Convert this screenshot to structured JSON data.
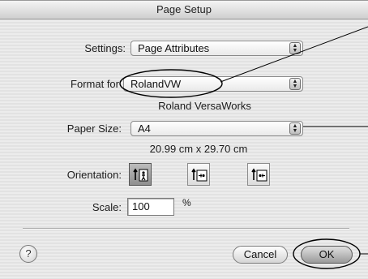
{
  "window": {
    "title": "Page Setup"
  },
  "settings": {
    "label": "Settings:",
    "value": "Page Attributes"
  },
  "format_for": {
    "label": "Format for",
    "value": "RolandVW",
    "printer_name": "Roland VersaWorks"
  },
  "paper_size": {
    "label": "Paper Size:",
    "value": "A4",
    "dimensions": "20.99 cm x 29.70 cm"
  },
  "orientation": {
    "label": "Orientation:",
    "selected": "portrait"
  },
  "scale": {
    "label": "Scale:",
    "value": "100",
    "unit": "%"
  },
  "buttons": {
    "help": "?",
    "cancel": "Cancel",
    "ok": "OK"
  },
  "colors": {
    "callout_line": "#000000",
    "dialog_bg": "#e8e8e8"
  }
}
